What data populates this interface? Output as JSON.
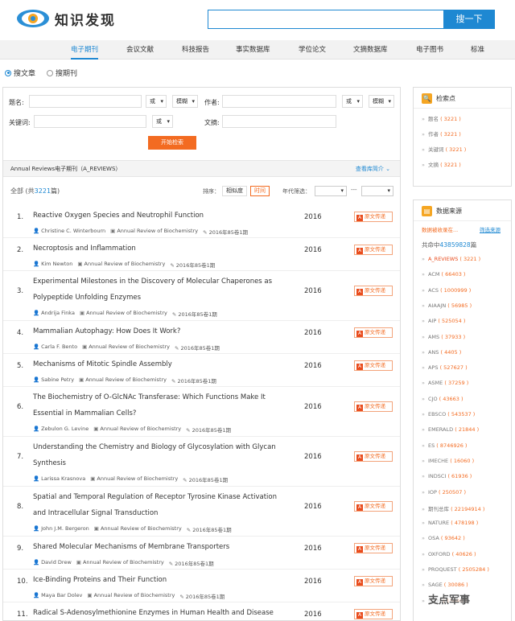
{
  "brand": {
    "name": "知识发现"
  },
  "search": {
    "button": "搜一下",
    "value": ""
  },
  "nav": [
    "电子期刊",
    "会议文献",
    "科技报告",
    "事实数据库",
    "学位论文",
    "文摘数据库",
    "电子图书",
    "标准"
  ],
  "radios": {
    "articles": "搜文章",
    "journals": "搜期刊"
  },
  "form": {
    "title_label": "题名:",
    "author_label": "作者:",
    "keyword_label": "关键词:",
    "abstract_label": "文摘:",
    "logic_or": "或",
    "fuzzy": "模糊",
    "start": "开始检索"
  },
  "section": {
    "title": "Annual Reviews电子期刊（A_REVIEWS）",
    "intro": "查看库简介 ⌄"
  },
  "toolbar": {
    "total_prefix": "全部 (共",
    "total": "3221",
    "total_suffix": "篇)",
    "sort_label": "排序：",
    "sort_relevance": "相似度",
    "sort_time": "时间",
    "year_label": "年代筛选：",
    "year_sep": "---"
  },
  "pdf_label": "原文传递",
  "results": [
    {
      "num": "1.",
      "title": "Reactive Oxygen Species and Neutrophil Function",
      "year": "2016",
      "author": "Christine C. Winterbourn",
      "journal": "Annual Review of Biochemistry",
      "issue": "2016年85卷1期"
    },
    {
      "num": "2.",
      "title": "Necroptosis and Inflammation",
      "year": "2016",
      "author": "Kim Newton",
      "journal": "Annual Review of Biochemistry",
      "issue": "2016年85卷1期"
    },
    {
      "num": "3.",
      "title": "Experimental Milestones in the Discovery of Molecular Chaperones as Polypeptide Unfolding Enzymes",
      "year": "2016",
      "author": "Andrija Finka",
      "journal": "Annual Review of Biochemistry",
      "issue": "2016年85卷1期"
    },
    {
      "num": "4.",
      "title": "Mammalian Autophagy: How Does It Work?",
      "year": "2016",
      "author": "Carla F. Bento",
      "journal": "Annual Review of Biochemistry",
      "issue": "2016年85卷1期"
    },
    {
      "num": "5.",
      "title": "Mechanisms of Mitotic Spindle Assembly",
      "year": "2016",
      "author": "Sabine Petry",
      "journal": "Annual Review of Biochemistry",
      "issue": "2016年85卷1期"
    },
    {
      "num": "6.",
      "title": "The Biochemistry of O-GlcNAc Transferase: Which Functions Make It Essential in Mammalian Cells?",
      "year": "2016",
      "author": "Zebulon G. Levine",
      "journal": "Annual Review of Biochemistry",
      "issue": "2016年85卷1期"
    },
    {
      "num": "7.",
      "title": "Understanding the Chemistry and Biology of Glycosylation with Glycan Synthesis",
      "year": "2016",
      "author": "Larissa Krasnova",
      "journal": "Annual Review of Biochemistry",
      "issue": "2016年85卷1期"
    },
    {
      "num": "8.",
      "title": "Spatial and Temporal Regulation of Receptor Tyrosine Kinase Activation and Intracellular Signal Transduction",
      "year": "2016",
      "author": "John J.M. Bergeron",
      "journal": "Annual Review of Biochemistry",
      "issue": "2016年85卷1期"
    },
    {
      "num": "9.",
      "title": "Shared Molecular Mechanisms of Membrane Transporters",
      "year": "2016",
      "author": "David Drew",
      "journal": "Annual Review of Biochemistry",
      "issue": "2016年85卷1期"
    },
    {
      "num": "10.",
      "title": "Ice-Binding Proteins and Their Function",
      "year": "2016",
      "author": "Maya Bar Dolev",
      "journal": "Annual Review of Biochemistry",
      "issue": "2016年85卷1期"
    },
    {
      "num": "11.",
      "title": "Radical S-Adenosylmethionine Enzymes in Human Health and Disease",
      "year": "2016",
      "author": "",
      "journal": "",
      "issue": ""
    }
  ],
  "facets": {
    "title": "检索点",
    "items": [
      {
        "label": "题名",
        "count": "3221"
      },
      {
        "label": "作者",
        "count": "3221"
      },
      {
        "label": "关键词",
        "count": "3221"
      },
      {
        "label": "文摘",
        "count": "3221"
      }
    ]
  },
  "sources": {
    "title": "数据来源",
    "collect": "数据被收录在...",
    "filter": "筛选来源",
    "total_prefix": "共命中",
    "total": "43859828",
    "total_suffix": "篇",
    "items": [
      {
        "label": "A_REVIEWS",
        "count": "3221"
      },
      {
        "label": "ACM",
        "count": "66403"
      },
      {
        "label": "ACS",
        "count": "1000999"
      },
      {
        "label": "AIAAJN",
        "count": "56985"
      },
      {
        "label": "AIP",
        "count": "525054"
      },
      {
        "label": "AMS",
        "count": "37933"
      },
      {
        "label": "ANS",
        "count": "4405"
      },
      {
        "label": "APS",
        "count": "527627"
      },
      {
        "label": "ASME",
        "count": "37259"
      },
      {
        "label": "CJO",
        "count": "43663"
      },
      {
        "label": "EBSCO",
        "count": "543537"
      },
      {
        "label": "EMERALD",
        "count": "21844"
      },
      {
        "label": "ES",
        "count": "8746926"
      },
      {
        "label": "IMECHE",
        "count": "16060"
      },
      {
        "label": "INDSCI",
        "count": "61936"
      },
      {
        "label": "IOP",
        "count": "250507"
      },
      {
        "label": "期刊总库",
        "count": "22194914"
      },
      {
        "label": "NATURE",
        "count": "478198"
      },
      {
        "label": "OSA",
        "count": "93642"
      },
      {
        "label": "OXFORD",
        "count": "40626"
      },
      {
        "label": "PROQUEST",
        "count": "2505284"
      },
      {
        "label": "SAGE",
        "count": "30086"
      },
      {
        "label": "SIAM",
        "count": "15648"
      }
    ]
  },
  "watermark": "支点军事",
  "colors": {
    "accent": "#1e88d2",
    "orange": "#f36b21"
  }
}
